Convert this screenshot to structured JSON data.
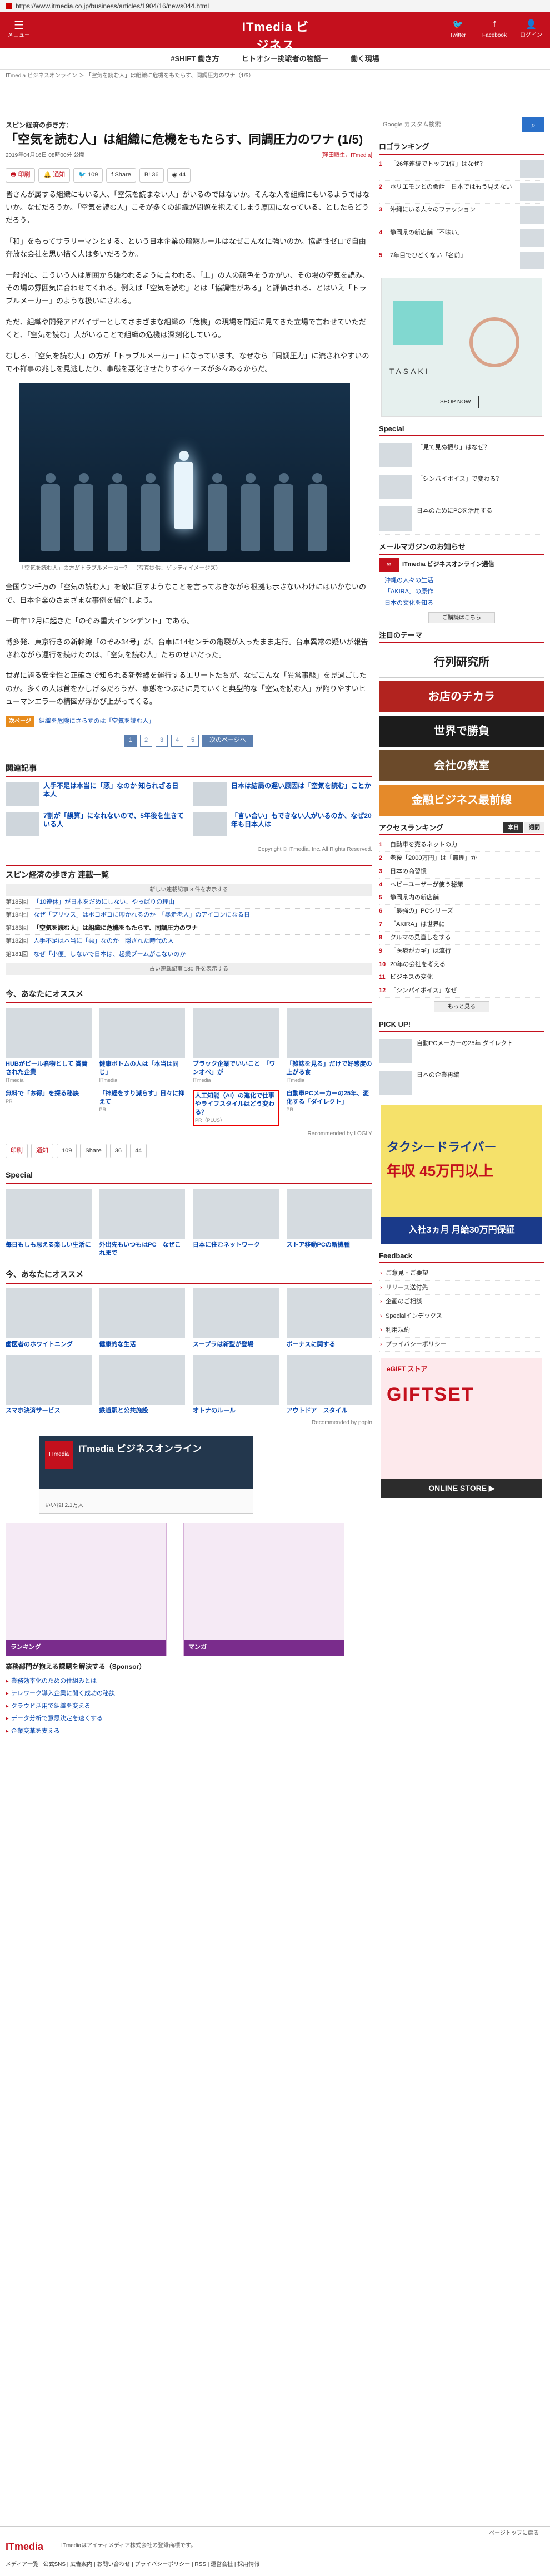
{
  "url": "https://www.itmedia.co.jp/business/articles/1904/16/news044.html",
  "header": {
    "menu_label": "メニュー",
    "brand": "ITmedia ビジネス",
    "brand_sub": "ONLINE",
    "icons": [
      {
        "label": "Twitter"
      },
      {
        "label": "Facebook"
      },
      {
        "label": "ログイン"
      }
    ]
  },
  "subnav": [
    "#SHIFT 働き方",
    "ヒトオシ一挑戦者の物語一",
    "働く現場"
  ],
  "breadcrumb": "ITmedia ビジネスオンライン ＞ 「空気を読む人」は組織に危機をもたらす、同調圧力のワナ（1/5）",
  "article": {
    "series": "スピン経済の歩き方：",
    "title": "「空気を読む人」は組織に危機をもたらす、同調圧力のワナ (1/5)",
    "date": "2019年04月16日 08時00分 公開",
    "author": "[窪田順生，ITmedia]",
    "share": [
      "印刷",
      "通知",
      "109",
      "Share",
      "36",
      "44"
    ],
    "para1": "皆さんが属する組織にもいる人、「空気を読まない人」がいるのではないか。そんな人を組織にもいるようではないか。なぜだろうか。「空気を読む人」こそが多くの組織が問題を抱えてしまう原因になっている、としたらどうだろう。",
    "para2": "「和」をもってサラリーマンとする、という日本企業の暗黙ルールはなぜこんなに強いのか。協調性ゼロで自由奔放な会社を思い描く人は多いだろうか。",
    "para3": "一般的に、こういう人は周囲から嫌われるように言われる。「上」の人の顔色をうかがい、その場の空気を読み、その場の雰囲気に合わせてくれる。例えば「空気を読む」とは「協調性がある」と評価される、とはいえ「トラブルメーカー」のような扱いにされる。",
    "para4": "ただ、組織や開発アドバイザーとしてさまざまな組織の「危機」の現場を間近に見てきた立場で言わせていただくと、「空気を読む」人がいることで組織の危機は深刻化している。",
    "para5": "むしろ、「空気を読む人」の方が「トラブルメーカー」になっています。なぜなら「同調圧力」に流されやすいので不祥事の兆しを見逃したり、事態を悪化させたりするケースが多々あるからだ。",
    "fig_caption": "「空気を読む人」の方がトラブルメーカー？　（写真提供：ゲッティイメージズ）",
    "para6": "全国ウン千万の「空気の読む人」を敵に回すようなことを言っておきながら根拠も示さないわけにはいかないので、日本企業のさまざまな事例を紹介しよう。",
    "para7": "一昨年12月に起きた「のぞみ重大インシデント」である。",
    "para8": "博多発、東京行きの新幹線「のぞみ34号」が、台車に14センチの亀裂が入ったまま走行。台車異常の疑いが報告されながら運行を続けたのは、「空気を読む人」たちのせいだった。",
    "para9": "世界に誇る安全性と正確さで知られる新幹線を運行するエリートたちが、なぜこんな「異常事態」を見過ごしたのか。多くの人は首をかしげるだろうが、事態をつぶさに見ていくと典型的な「空気を読む人」が陥りやすいヒューマンエラーの構図が浮かび上がってくる。",
    "next_tag": "次ページ",
    "next_link": "組織を危険にさらすのは「空気を読む人」",
    "pages": [
      "1",
      "2",
      "3",
      "4",
      "5",
      "次のページへ"
    ]
  },
  "related": {
    "heading": "関連記事",
    "items": [
      "人手不足は本当に「悪」なのか 知られざる日本人",
      "日本は結局の遅い原因は「空気を読む」ことか",
      "7割が「誤算」になれないので、5年後を生きている人",
      "「言い合い」もできない人がいるのか、なぜ20年も日本人は"
    ]
  },
  "copyright": "Copyright © ITmedia, Inc. All Rights Reserved.",
  "series_box": {
    "heading": "スピン経済の歩き方 連載一覧",
    "new_label": "新しい連載記事 8 件を表示する",
    "rows": [
      {
        "n": "第185回",
        "l": "「10連休」が日本をだめにしない、やっぱりの理由"
      },
      {
        "n": "第184回",
        "l": "なぜ「プリウス」はボコボコに叩かれるのか　「暴走老人」のアイコンになる日"
      },
      {
        "n": "第183回",
        "l": "「空気を読む人」は組織に危機をもたらす、同調圧力のワナ"
      },
      {
        "n": "第182回",
        "l": "人手不足は本当に「悪」なのか　隠された時代の人"
      },
      {
        "n": "第181回",
        "l": "なぜ「小便」しないで日本は、起業ブームがこないのか"
      }
    ],
    "all_label": "古い連載記事 180 件を表示する"
  },
  "recommend": {
    "heading": "今、あなたにオススメ",
    "cards": [
      {
        "t": "HUBがビール名物として 賞賛された企業",
        "s": "ITmedia"
      },
      {
        "t": "健康ボトムの人は「本当は同じ」",
        "s": "ITmedia"
      },
      {
        "t": "ブラック企業でいいこと　「ワンオペ」が",
        "s": "ITmedia"
      },
      {
        "t": "「雑誌を見る」だけで好感度の上がる食",
        "s": "ITmedia"
      },
      {
        "t": "無料で「お得」を探る秘訣",
        "s": "PR"
      },
      {
        "t": "「神経をすり減らす」日々に抑えて",
        "s": "PR"
      },
      {
        "t": "人工知能（AI）の進化で仕事やライフスタイルはどう変わる？",
        "s": "PR（PLUS）"
      },
      {
        "t": "自動車PCメーカーの25年、変化する「ダイレクト」",
        "s": "PR"
      }
    ],
    "rec_by": "Recommended by LOGLY"
  },
  "special": {
    "heading": "Special",
    "items": [
      "毎日もしも思える楽しい生活に",
      "外出先もいつもはPC　なぜこれまで",
      "日本に住むネットワーク",
      "ストア移動PCの新機種"
    ]
  },
  "recommend2": {
    "heading": "今、あなたにオススメ",
    "cards": [
      "歯医者のホワイトニング",
      "健康的な生活",
      "スープラは新型が登場",
      "ボーナスに関する",
      "スマホ決済サービス",
      "鉄道駅と公共施設",
      "オトナのルール",
      "アウトドア　スタイル"
    ],
    "rec_by": "Recommended by popIn"
  },
  "tweet": {
    "name": "ITmedia ビジネスオンライン",
    "logo": "ITmedia",
    "follow": "いいね! 2.1万人"
  },
  "comics": [
    "ランキング",
    "マンガ"
  ],
  "sponsor": {
    "heading": "業務部門が抱える課題を解決する（Sponsor）",
    "links": [
      "業務効率化のための仕組みとは",
      "テレワーク導入企業に聞く成功の秘訣",
      "クラウド活用で組織を変える",
      "データ分析で意思決定を速くする",
      "企業変革を支える"
    ]
  },
  "footer": {
    "logo": "ITmedia",
    "text": "ITmediaはアイティメディア株式会社の登録商標です。",
    "links": "メディア一覧 | 公式SNS | 広告案内 | お問い合わせ | プライバシーポリシー | RSS | 運営会社 | 採用情報",
    "pagetop": "ページトップに戻る"
  },
  "sidebar": {
    "search_placeholder": "Google カスタム検索",
    "pickup_heading": "ロゴランキング",
    "pickup": [
      "「26年連続でトップ1位」はなぜ？",
      "ホリエモンとの会話　日本ではもう見えない",
      "沖縄にいる人々のファッション",
      "静岡県の新店舗「不味い」",
      "7年目でひどくない「名前」",
      "「3年目でも見えない」"
    ],
    "ad_brand": "TASAKI",
    "ad_shop": "SHOP NOW",
    "special_heading": "Special",
    "special": [
      "「見て見ぬ振り」はなぜ？",
      "「シンパイボイス」で変わる？",
      "日本のためにPCを活用する"
    ],
    "mail_heading": "メールマガジンのお知らせ",
    "mail_title": "ITmedia ビジネスオンライン通信",
    "mail_lines": [
      "沖縄の人々の生活",
      "「AKIRA」の原作",
      "日本の文化を知る"
    ],
    "mail_btn": "ご購読はこちら",
    "theme_heading": "注目のテーマ",
    "banners": [
      "行列研究所",
      "お店のチカラ",
      "世界で勝負",
      "会社の教室",
      "金融ビジネス最前線"
    ],
    "access_heading": "アクセスランキング",
    "access_tabs": [
      "本日",
      "週間"
    ],
    "access": [
      "自動車を売るネットの力",
      "老後「2000万円」は「無理」か",
      "日本の商習慣",
      "ヘビーユーザーが使う秘策",
      "静岡県内の新店舗",
      "「最強の」PCシリーズ",
      "「AKIRA」は世界に",
      "クルマの見直しをする",
      "「医療がカギ」は流行",
      "20年の会社を考える",
      "ビジネスの変化",
      "「シンパイボイス」なぜ"
    ],
    "more_btn": "もっと見る",
    "pickup2_heading": "PICK UP!",
    "pickup2": [
      "自動PCメーカーの25年 ダイレクト",
      "日本の企業再編"
    ],
    "taxi_a": "タクシードライバー",
    "taxi_b": "年収 45万円以上",
    "taxi_c": "入社3ヵ月 月給30万円保証",
    "feedback_heading": "Feedback",
    "feedback": [
      "ご意見・ご要望",
      "リリース送付先",
      "企画のご相談",
      "Specialインデックス",
      "利用規約",
      "プライバシーポリシー"
    ],
    "gift_t1": "eGIFT ストア",
    "gift_t2": "GIFTSET",
    "gift_t3": "ONLINE STORE ▶"
  }
}
